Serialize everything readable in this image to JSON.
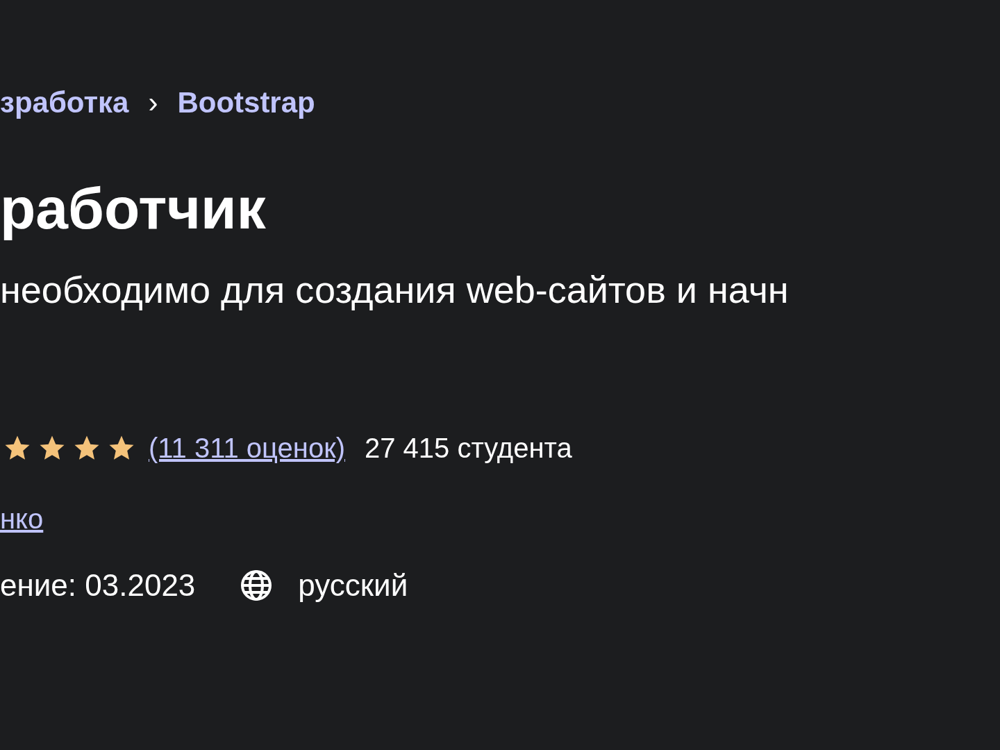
{
  "breadcrumb": [
    {
      "label": "зработка"
    },
    {
      "label": "Bootstrap"
    }
  ],
  "breadcrumb_separator": "›",
  "title": "работчик",
  "subtitle": "необходимо для создания web-сайтов и начн",
  "rating": {
    "stars": 4,
    "count": "(11 311 оценок)",
    "students": "27 415 студента"
  },
  "author": "нко",
  "updated": "ение: 03.2023",
  "language": "русский"
}
